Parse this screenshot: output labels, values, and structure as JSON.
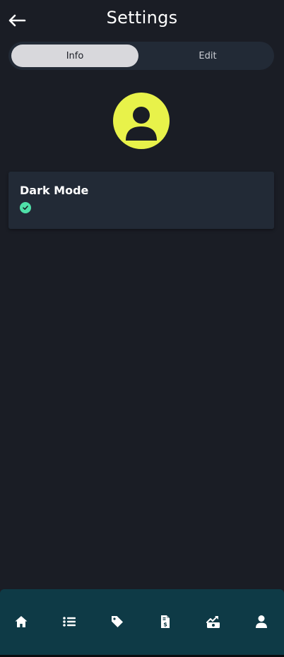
{
  "header": {
    "title": "Settings",
    "back_icon": "arrow-left-icon"
  },
  "tabs": [
    {
      "label": "Info",
      "active": true
    },
    {
      "label": "Edit",
      "active": false
    }
  ],
  "profile": {
    "avatar_icon": "user-avatar-icon"
  },
  "settings": [
    {
      "label": "Dark Mode",
      "enabled": true,
      "status_icon": "check-circle-icon"
    }
  ],
  "nav": {
    "items": [
      {
        "icon": "home-icon"
      },
      {
        "icon": "list-icon"
      },
      {
        "icon": "tag-icon"
      },
      {
        "icon": "invoice-icon"
      },
      {
        "icon": "money-growth-icon"
      },
      {
        "icon": "user-icon"
      }
    ]
  },
  "colors": {
    "background": "#1a1d25",
    "card": "#222a36",
    "accent_avatar": "#e8f24a",
    "check": "#4fe0a8",
    "nav_bar": "#0e3a46",
    "tab_active": "#d8d8dc"
  }
}
